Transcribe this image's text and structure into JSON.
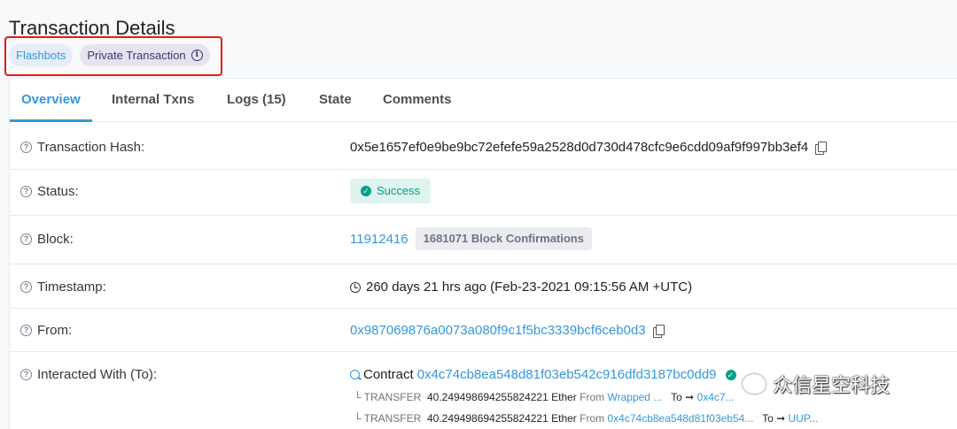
{
  "header": {
    "title": "Transaction Details",
    "badges": [
      "Flashbots",
      "Private Transaction"
    ]
  },
  "tabs": [
    "Overview",
    "Internal Txns",
    "Logs (15)",
    "State",
    "Comments"
  ],
  "rows": {
    "hash": {
      "label": "Transaction Hash:",
      "value": "0x5e1657ef0e9be9bc72efefe59a2528d0d730d478cfc9e6cdd09af9f997bb3ef4"
    },
    "status": {
      "label": "Status:",
      "value": "Success"
    },
    "block": {
      "label": "Block:",
      "value": "11912416",
      "confirmations": "1681071 Block Confirmations"
    },
    "timestamp": {
      "label": "Timestamp:",
      "value": "260 days 21 hrs ago (Feb-23-2021 09:15:56 AM +UTC)"
    },
    "from": {
      "label": "From:",
      "value": "0x987069876a0073a080f9c1f5bc3339bcf6ceb0d3"
    },
    "interacted": {
      "label": "Interacted With (To):",
      "contract_prefix": "Contract",
      "contract": "0x4c74cb8ea548d81f03eb542c916dfd3187bc0dd9",
      "transfers": [
        {
          "prefix": "└ TRANSFER",
          "amount": "40.249498694255824221",
          "unit": "Ether",
          "from_label": "From",
          "from": "Wrapped ...",
          "to_label": "To ➞",
          "to": "0x4c7..."
        },
        {
          "prefix": "└ TRANSFER",
          "amount": "40.249498694255824221",
          "unit": "Ether",
          "from_label": "From",
          "from": "0x4c74cb8ea548d81f03eb54...",
          "to_label": "To ➞",
          "to": "UUP..."
        }
      ]
    }
  },
  "watermark": "众信星空科技",
  "colors": {
    "accent": "#3498db",
    "success": "#00a186",
    "annotation": "#e11b1b"
  }
}
